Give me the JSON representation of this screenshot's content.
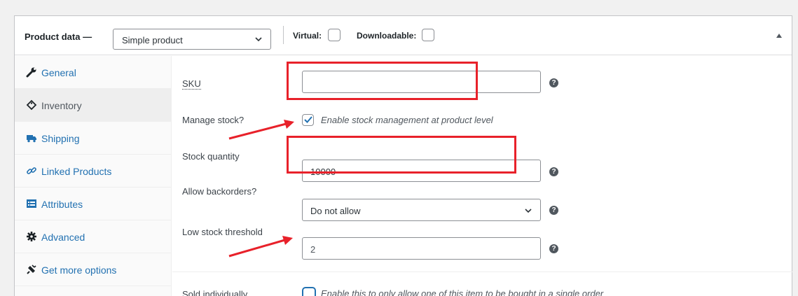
{
  "header": {
    "title": "Product data —",
    "product_type": "Simple product",
    "virtual_label": "Virtual:",
    "downloadable_label": "Downloadable:"
  },
  "tabs": [
    {
      "label": "General",
      "icon": "wrench-icon",
      "active": false
    },
    {
      "label": "Inventory",
      "icon": "tag-icon",
      "active": true
    },
    {
      "label": "Shipping",
      "icon": "truck-icon",
      "active": false
    },
    {
      "label": "Linked Products",
      "icon": "link-icon",
      "active": false
    },
    {
      "label": "Attributes",
      "icon": "list-icon",
      "active": false
    },
    {
      "label": "Advanced",
      "icon": "gear-icon",
      "active": false
    },
    {
      "label": "Get more options",
      "icon": "plugin-icon",
      "active": false
    }
  ],
  "fields": {
    "sku": {
      "label": "SKU",
      "value": ""
    },
    "manage_stock": {
      "label": "Manage stock?",
      "description": "Enable stock management at product level",
      "checked": true
    },
    "stock_quantity": {
      "label": "Stock quantity",
      "value": "10000"
    },
    "backorders": {
      "label": "Allow backorders?",
      "value": "Do not allow"
    },
    "low_stock": {
      "label": "Low stock threshold",
      "value": "2"
    },
    "sold_individually": {
      "label": "Sold individually",
      "description": "Enable this to only allow one of this item to be bought in a single order",
      "checked": false
    }
  },
  "help_glyph": "?",
  "colors": {
    "link": "#2271b1",
    "annotation_red": "#e8212a",
    "checkbox_accent": "#2271b1"
  }
}
